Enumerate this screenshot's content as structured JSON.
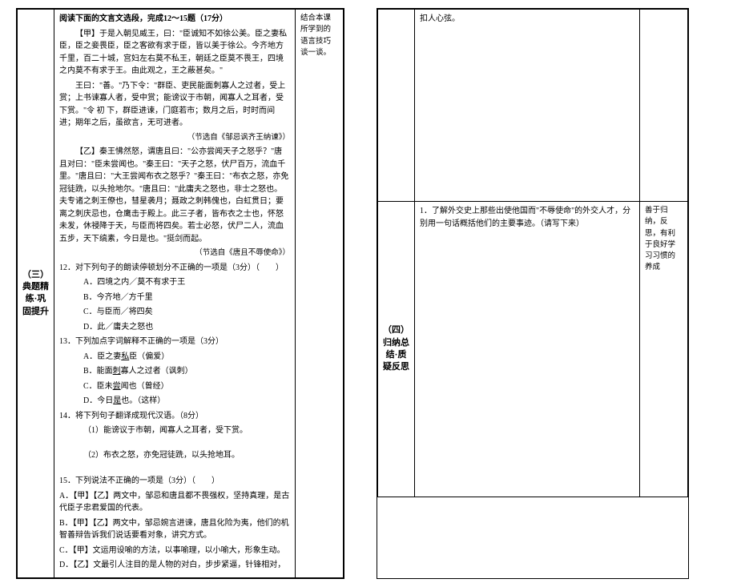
{
  "left": {
    "section_label": "（三）典题精练·巩固提升",
    "header": "阅读下面的文言文选段，完成12～15题（17分）",
    "jia_label": "【甲】",
    "jia_p1": "于是入朝见威王，曰：\"臣诚知不如徐公美。臣之妻私臣，臣之妾畏臣，臣之客欲有求于臣，皆以美于徐公。今齐地方千里，百二十城，宫妇左右莫不私王，朝廷之臣莫不畏王，四境之内莫不有求于王。由此观之，王之蔽甚矣。\"",
    "jia_p2": "王曰：\"善。\"乃下令：\"群臣、吏民能面刺寡人之过者，受上赏；上书谏寡人者，受中赏；能谤议于市朝，闻寡人之耳者，受下赏。\"令 初 下，群臣进谏，门庭若市；数月之后，时时而间进；期年之后，虽欲言，无可进者。",
    "jia_src": "（节选自《邹忌讽齐王纳谏》）",
    "yi_label": "【乙】",
    "yi_p1": "秦王怫然怒，谓唐且曰：\"公亦尝闻天子之怒乎？\"唐且对曰：\"臣未尝闻也。\"秦王曰：\"天子之怒，伏尸百万，流血千里。\"唐且曰：\"大王尝闻布衣之怒乎？\"秦王曰：\"布衣之怒，亦免冠徒跣，以头抢地尔。\"唐且曰：\"此庸夫之怒也，非士之怒也。夫专诸之刺王僚也，彗星袭月；聂政之刺韩傀也，白虹贯日；要离之刺庆忌也，仓鹰击于殿上。此三子者，皆布衣之士也，怀怒未发，休祲降于天，与臣而将四矣。若士必怒，伏尸二人，流血五步，天下缟素，今日是也。\"挺剑而起。",
    "yi_src": "（节选自《唐且不辱使命》）",
    "q12": "12．对下列句子的朗读停顿划分不正确的一项是（3分）（　　）",
    "q12a": "A．四境之内／莫不有求于王",
    "q12b": "B．今齐地／方千里",
    "q12c": "C．与臣而／将四矣",
    "q12d": "D．此／庸夫之怒也",
    "q13": "13．下列加点字词解释不正确的一项是（3分）",
    "q13a_pre": "A．臣之妻",
    "q13a_u": "私",
    "q13a_post": "臣（偏爱）",
    "q13b_pre": "B．能面",
    "q13b_u": "刺",
    "q13b_post": "寡人之过者（讽刺）",
    "q13c_pre": "C．臣未",
    "q13c_u": "尝",
    "q13c_post": "闻也（曾经）",
    "q13d_pre": "D．今日",
    "q13d_u": "是",
    "q13d_post": "也。（这样）",
    "q14": "14．将下列句子翻译成现代汉语。（8分）",
    "q14_1": "（1）能谤议于市朝，闻寡人之耳者，受下赏。",
    "q14_2": "（2）布衣之怒，亦免冠徒跣，以头抢地耳。",
    "q15": "15．下列说法不正确的一项是（3分）（　　）",
    "q15a": "A．【甲】【乙】两文中，邹忌和唐且都不畏强权，坚持真理，是古代臣子忠君爱国的代表。",
    "q15b": "B．【甲】【乙】两文中，邹忌婉言进谏，唐且化险为夷，他们的机智善辩告诉我们说话要看对象，讲究方式。",
    "q15c": "C．【甲】文运用设喻的方法，以事喻理，以小喻大，形象生动。",
    "q15d": "D．【乙】文最引人注目的是人物的对白，步步紧逼，针锋相对，",
    "notes": "结合本课所学到的语言技巧谈一谈。"
  },
  "right": {
    "top_text": "扣人心弦。",
    "section_label": "（四）归纳总结·质疑反思",
    "task": "1．了解外交史上那些出使他国而\"不辱使命\"的外交人才，分别用一句话概括他们的主要事迹。（请写下来）",
    "notes": "善于归纳，反思，有利于良好学习习惯的养成"
  }
}
